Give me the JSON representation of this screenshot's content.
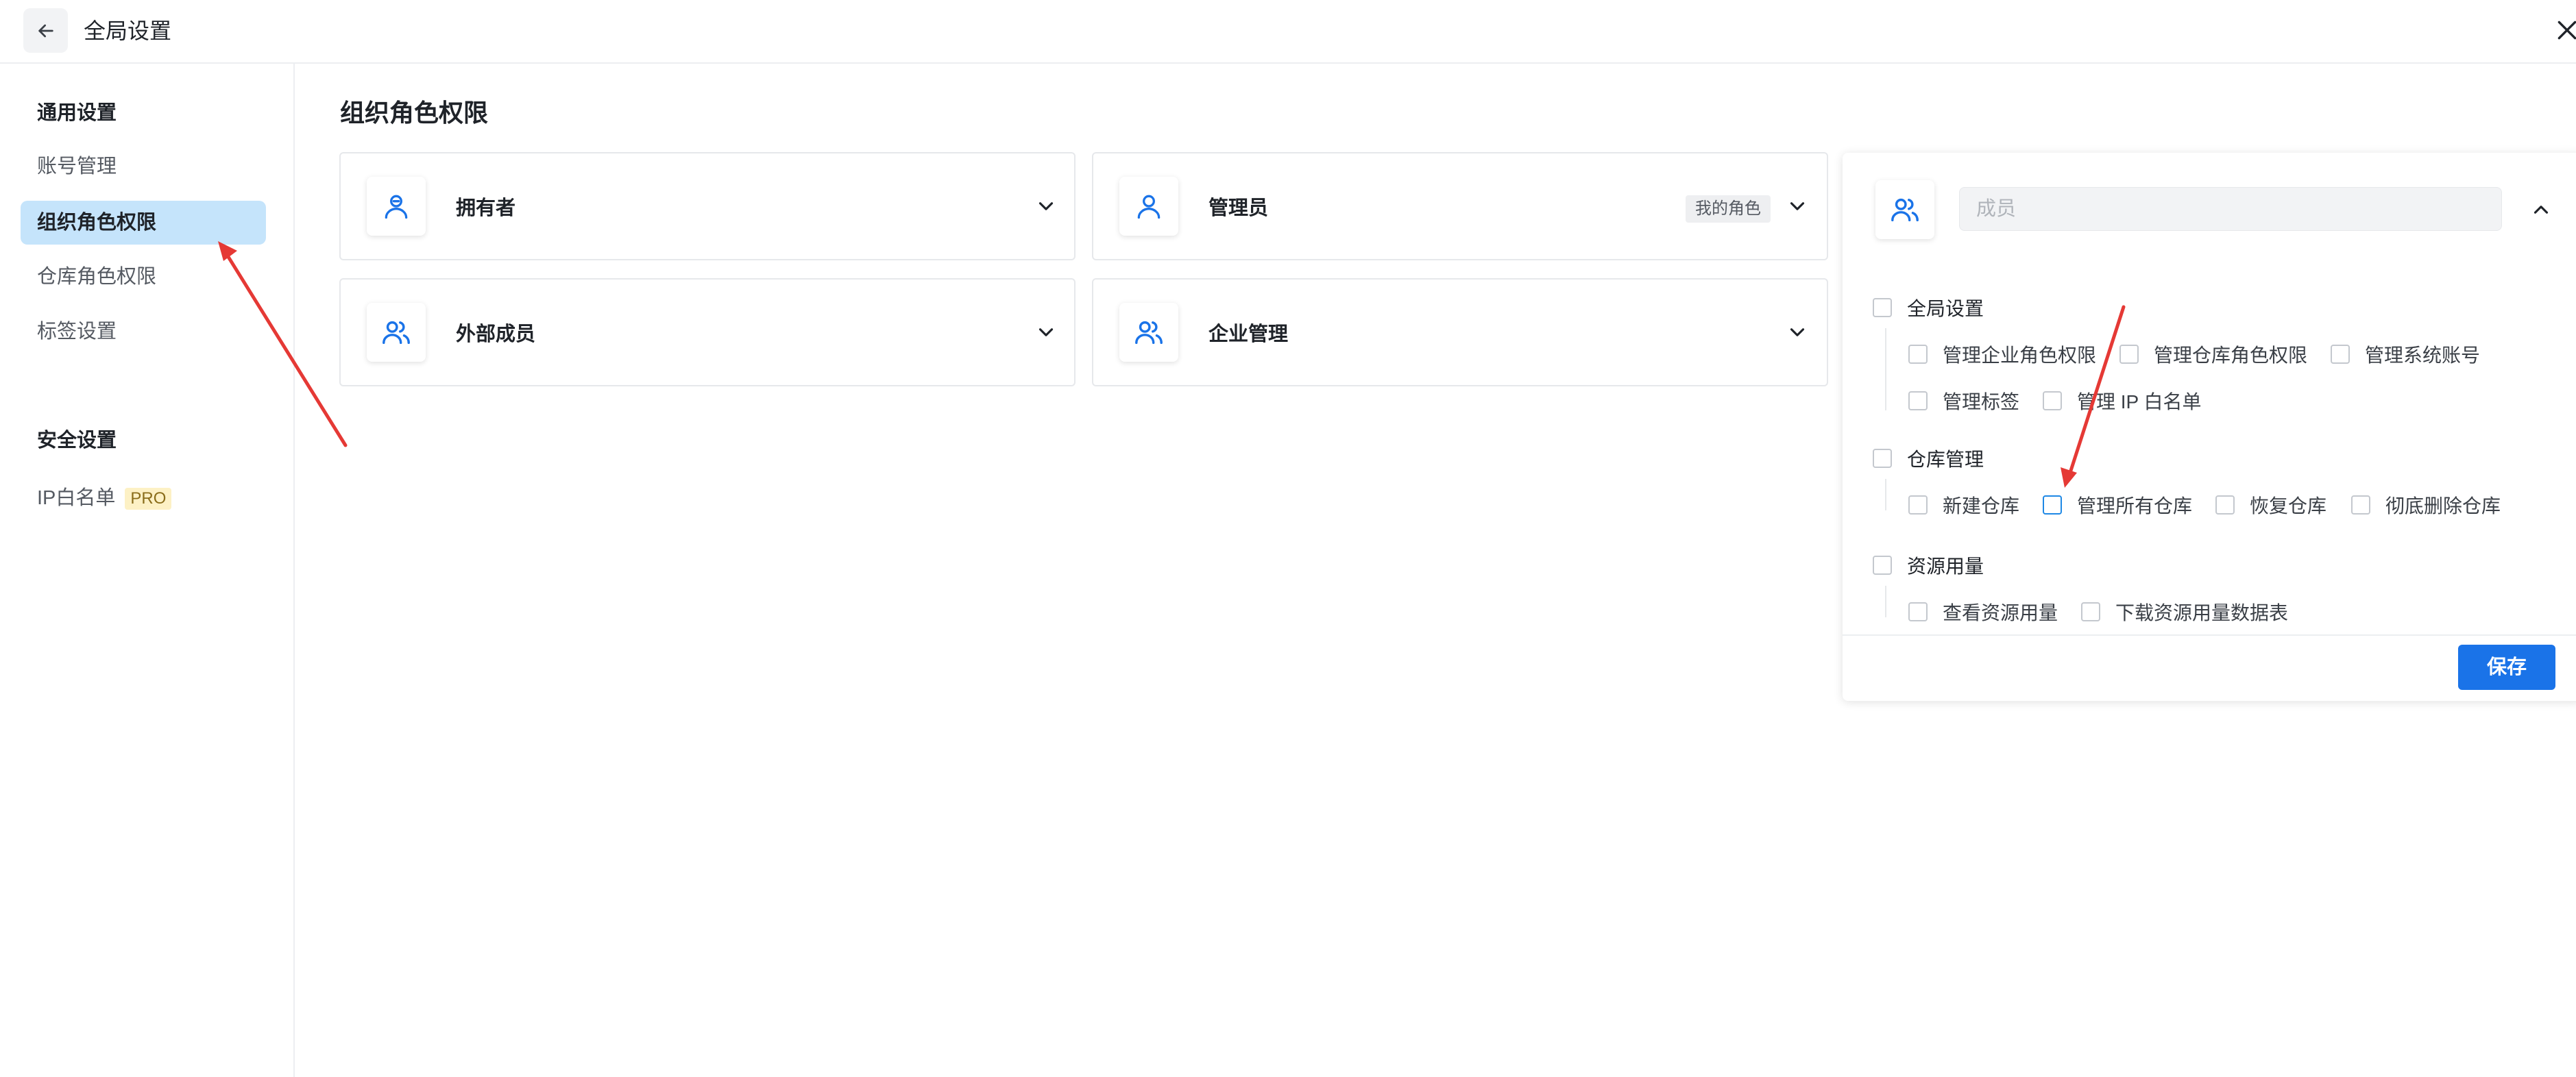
{
  "header": {
    "title": "全局设置"
  },
  "sidebar": {
    "groups": [
      {
        "label": "通用设置"
      },
      {
        "label": "安全设置"
      }
    ],
    "items": [
      {
        "label": "账号管理"
      },
      {
        "label": "组织角色权限"
      },
      {
        "label": "仓库角色权限"
      },
      {
        "label": "标签设置"
      },
      {
        "label": "IP白名单",
        "badge": "PRO"
      }
    ],
    "active_item": "组织角色权限"
  },
  "main": {
    "title": "组织角色权限",
    "roles": [
      {
        "name": "拥有者"
      },
      {
        "name": "管理员",
        "badge": "我的角色"
      },
      {
        "name": "外部成员"
      },
      {
        "name": "企业管理"
      }
    ]
  },
  "panel": {
    "placeholder": "成员",
    "groups": [
      {
        "label": "全局设置",
        "items": [
          "管理企业角色权限",
          "管理仓库角色权限",
          "管理系统账号",
          "管理标签",
          "管理 IP 白名单"
        ]
      },
      {
        "label": "仓库管理",
        "items": [
          "新建仓库",
          "管理所有仓库",
          "恢复仓库",
          "彻底删除仓库"
        ]
      },
      {
        "label": "资源用量",
        "items": [
          "查看资源用量",
          "下载资源用量数据表"
        ]
      }
    ],
    "save_label": "保存"
  },
  "colors": {
    "accent": "#1a73e8",
    "active_nav_bg": "#c5e4fb",
    "annotation_arrow": "#e53935",
    "role_icon": "#1a73e8"
  }
}
